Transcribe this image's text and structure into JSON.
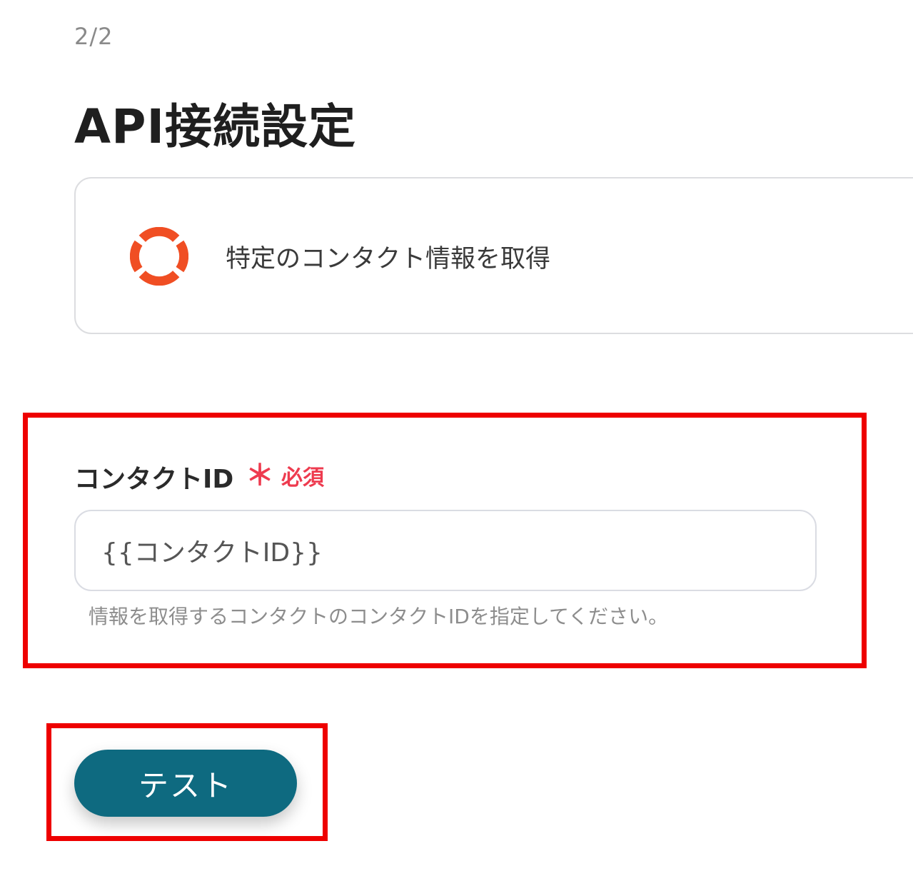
{
  "header": {
    "step": "2/2",
    "title": "API接続設定"
  },
  "action": {
    "icon": "hubspot-ring-icon",
    "label": "特定のコンタクト情報を取得"
  },
  "form": {
    "field_label": "コンタクトID",
    "required_mark": "＊",
    "required_text": "必須",
    "input_value": "{{コンタクトID}}",
    "help_text": "情報を取得するコンタクトのコンタクトIDを指定してください。"
  },
  "buttons": {
    "test_label": "テスト"
  },
  "colors": {
    "accent": "#0e6a80",
    "required": "#ee3b4f",
    "icon": "#f04e23",
    "highlight": "#ee0000"
  }
}
